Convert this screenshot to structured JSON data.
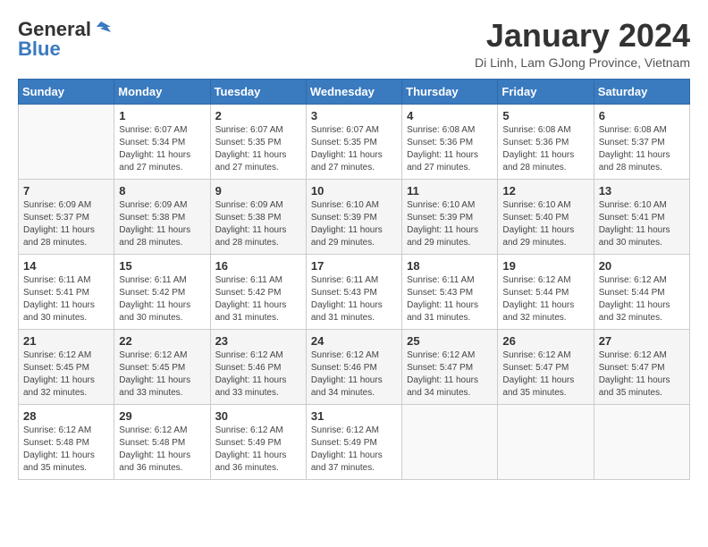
{
  "header": {
    "logo_general": "General",
    "logo_blue": "Blue",
    "month_title": "January 2024",
    "location": "Di Linh, Lam GJong Province, Vietnam"
  },
  "days_of_week": [
    "Sunday",
    "Monday",
    "Tuesday",
    "Wednesday",
    "Thursday",
    "Friday",
    "Saturday"
  ],
  "weeks": [
    [
      {
        "day": "",
        "info": ""
      },
      {
        "day": "1",
        "info": "Sunrise: 6:07 AM\nSunset: 5:34 PM\nDaylight: 11 hours\nand 27 minutes."
      },
      {
        "day": "2",
        "info": "Sunrise: 6:07 AM\nSunset: 5:35 PM\nDaylight: 11 hours\nand 27 minutes."
      },
      {
        "day": "3",
        "info": "Sunrise: 6:07 AM\nSunset: 5:35 PM\nDaylight: 11 hours\nand 27 minutes."
      },
      {
        "day": "4",
        "info": "Sunrise: 6:08 AM\nSunset: 5:36 PM\nDaylight: 11 hours\nand 27 minutes."
      },
      {
        "day": "5",
        "info": "Sunrise: 6:08 AM\nSunset: 5:36 PM\nDaylight: 11 hours\nand 28 minutes."
      },
      {
        "day": "6",
        "info": "Sunrise: 6:08 AM\nSunset: 5:37 PM\nDaylight: 11 hours\nand 28 minutes."
      }
    ],
    [
      {
        "day": "7",
        "info": "Sunrise: 6:09 AM\nSunset: 5:37 PM\nDaylight: 11 hours\nand 28 minutes."
      },
      {
        "day": "8",
        "info": "Sunrise: 6:09 AM\nSunset: 5:38 PM\nDaylight: 11 hours\nand 28 minutes."
      },
      {
        "day": "9",
        "info": "Sunrise: 6:09 AM\nSunset: 5:38 PM\nDaylight: 11 hours\nand 28 minutes."
      },
      {
        "day": "10",
        "info": "Sunrise: 6:10 AM\nSunset: 5:39 PM\nDaylight: 11 hours\nand 29 minutes."
      },
      {
        "day": "11",
        "info": "Sunrise: 6:10 AM\nSunset: 5:39 PM\nDaylight: 11 hours\nand 29 minutes."
      },
      {
        "day": "12",
        "info": "Sunrise: 6:10 AM\nSunset: 5:40 PM\nDaylight: 11 hours\nand 29 minutes."
      },
      {
        "day": "13",
        "info": "Sunrise: 6:10 AM\nSunset: 5:41 PM\nDaylight: 11 hours\nand 30 minutes."
      }
    ],
    [
      {
        "day": "14",
        "info": "Sunrise: 6:11 AM\nSunset: 5:41 PM\nDaylight: 11 hours\nand 30 minutes."
      },
      {
        "day": "15",
        "info": "Sunrise: 6:11 AM\nSunset: 5:42 PM\nDaylight: 11 hours\nand 30 minutes."
      },
      {
        "day": "16",
        "info": "Sunrise: 6:11 AM\nSunset: 5:42 PM\nDaylight: 11 hours\nand 31 minutes."
      },
      {
        "day": "17",
        "info": "Sunrise: 6:11 AM\nSunset: 5:43 PM\nDaylight: 11 hours\nand 31 minutes."
      },
      {
        "day": "18",
        "info": "Sunrise: 6:11 AM\nSunset: 5:43 PM\nDaylight: 11 hours\nand 31 minutes."
      },
      {
        "day": "19",
        "info": "Sunrise: 6:12 AM\nSunset: 5:44 PM\nDaylight: 11 hours\nand 32 minutes."
      },
      {
        "day": "20",
        "info": "Sunrise: 6:12 AM\nSunset: 5:44 PM\nDaylight: 11 hours\nand 32 minutes."
      }
    ],
    [
      {
        "day": "21",
        "info": "Sunrise: 6:12 AM\nSunset: 5:45 PM\nDaylight: 11 hours\nand 32 minutes."
      },
      {
        "day": "22",
        "info": "Sunrise: 6:12 AM\nSunset: 5:45 PM\nDaylight: 11 hours\nand 33 minutes."
      },
      {
        "day": "23",
        "info": "Sunrise: 6:12 AM\nSunset: 5:46 PM\nDaylight: 11 hours\nand 33 minutes."
      },
      {
        "day": "24",
        "info": "Sunrise: 6:12 AM\nSunset: 5:46 PM\nDaylight: 11 hours\nand 34 minutes."
      },
      {
        "day": "25",
        "info": "Sunrise: 6:12 AM\nSunset: 5:47 PM\nDaylight: 11 hours\nand 34 minutes."
      },
      {
        "day": "26",
        "info": "Sunrise: 6:12 AM\nSunset: 5:47 PM\nDaylight: 11 hours\nand 35 minutes."
      },
      {
        "day": "27",
        "info": "Sunrise: 6:12 AM\nSunset: 5:47 PM\nDaylight: 11 hours\nand 35 minutes."
      }
    ],
    [
      {
        "day": "28",
        "info": "Sunrise: 6:12 AM\nSunset: 5:48 PM\nDaylight: 11 hours\nand 35 minutes."
      },
      {
        "day": "29",
        "info": "Sunrise: 6:12 AM\nSunset: 5:48 PM\nDaylight: 11 hours\nand 36 minutes."
      },
      {
        "day": "30",
        "info": "Sunrise: 6:12 AM\nSunset: 5:49 PM\nDaylight: 11 hours\nand 36 minutes."
      },
      {
        "day": "31",
        "info": "Sunrise: 6:12 AM\nSunset: 5:49 PM\nDaylight: 11 hours\nand 37 minutes."
      },
      {
        "day": "",
        "info": ""
      },
      {
        "day": "",
        "info": ""
      },
      {
        "day": "",
        "info": ""
      }
    ]
  ]
}
